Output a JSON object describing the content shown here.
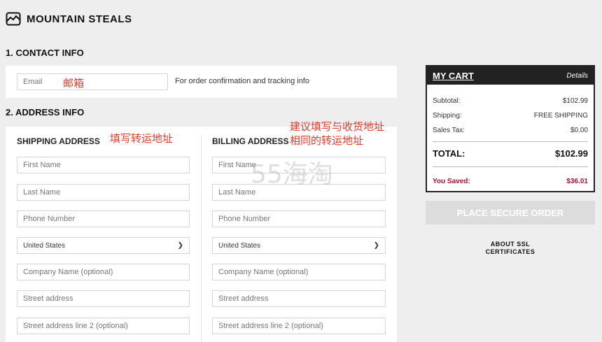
{
  "header": {
    "brand": "MOUNTAIN STEALS",
    "logo_icon": "mountain-logo-icon"
  },
  "contact": {
    "section_title": "1. CONTACT INFO",
    "email_placeholder": "Email",
    "hint": "For order confirmation and tracking info",
    "annotation": "邮箱"
  },
  "address": {
    "section_title": "2. ADDRESS INFO",
    "shipping": {
      "heading": "SHIPPING ADDRESS",
      "annotation": "填写转运地址",
      "first_name": "First Name",
      "last_name": "Last Name",
      "phone": "Phone Number",
      "country": "United States",
      "company": "Company Name (optional)",
      "street": "Street address",
      "street2": "Street address line 2 (optional)"
    },
    "billing": {
      "heading": "BILLING ADDRESS",
      "annotation_line1": "建议填写与收货地址",
      "annotation_line2": "相同的转运地址",
      "first_name": "First Name",
      "last_name": "Last Name",
      "phone": "Phone Number",
      "country": "United States",
      "company": "Company Name (optional)",
      "street": "Street address",
      "street2": "Street address line 2 (optional)"
    }
  },
  "watermark": "55海淘",
  "cart": {
    "title": "MY CART",
    "details_link": "Details",
    "subtotal_label": "Subtotal:",
    "subtotal_value": "$102.99",
    "shipping_label": "Shipping:",
    "shipping_value": "FREE SHIPPING",
    "tax_label": "Sales Tax:",
    "tax_value": "$0.00",
    "total_label": "TOTAL:",
    "total_value": "$102.99",
    "saved_label": "You Saved:",
    "saved_value": "$36.01"
  },
  "place_order_label": "PLACE SECURE ORDER",
  "ssl_line1": "ABOUT SSL",
  "ssl_line2": "CERTIFICATES",
  "colors": {
    "accent_red": "#b3132b",
    "annotation_red": "#e03b2b",
    "dark": "#222222"
  }
}
